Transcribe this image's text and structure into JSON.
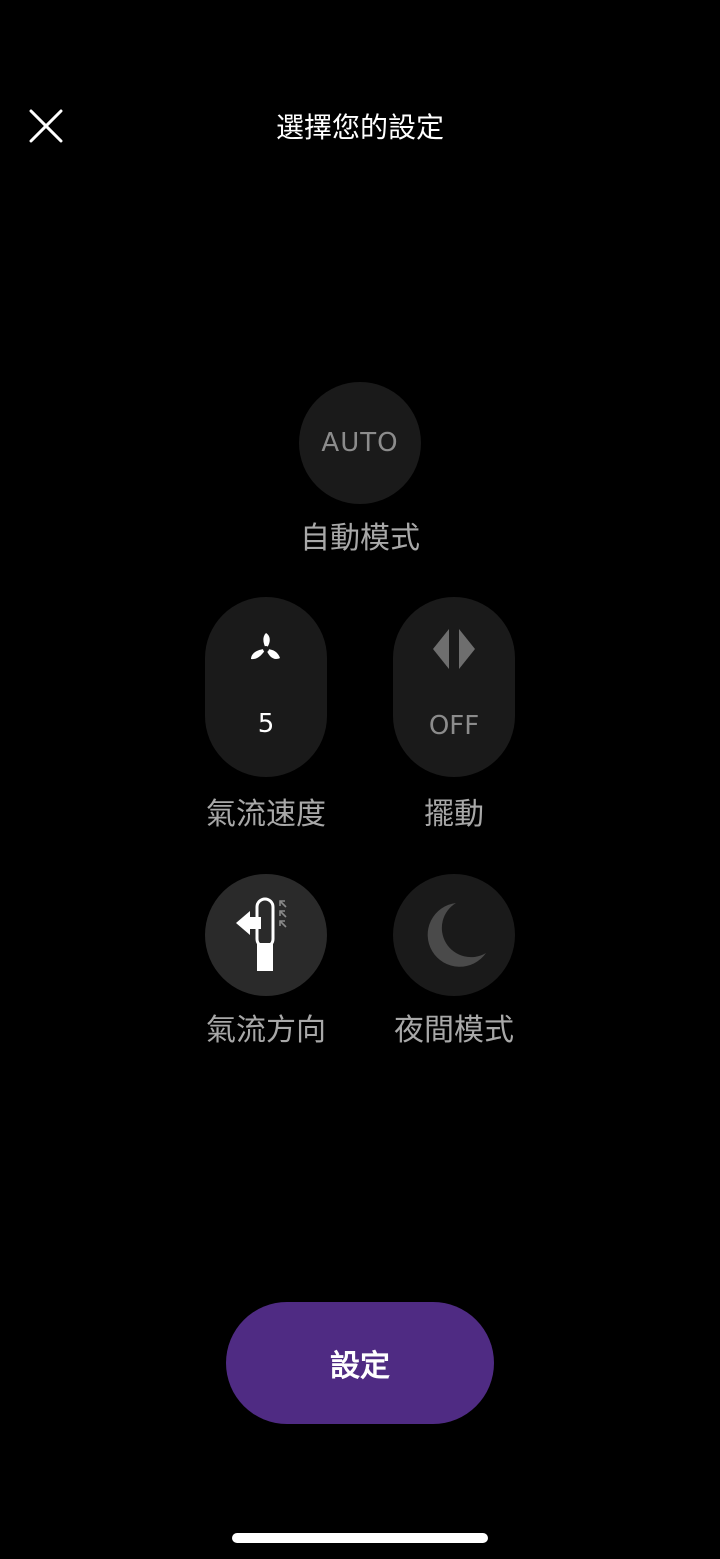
{
  "header": {
    "title": "選擇您的設定",
    "close_icon": "close-icon"
  },
  "controls": {
    "auto": {
      "value": "AUTO",
      "label": "自動模式"
    },
    "airflow_speed": {
      "icon": "fan-icon",
      "value": "5",
      "label": "氣流速度"
    },
    "oscillation": {
      "icon": "oscillation-icon",
      "value": "OFF",
      "label": "擺動"
    },
    "airflow_direction": {
      "icon": "airflow-direction-icon",
      "label": "氣流方向"
    },
    "night_mode": {
      "icon": "moon-icon",
      "label": "夜間模式"
    }
  },
  "footer": {
    "set_label": "設定"
  },
  "colors": {
    "background": "#000000",
    "control_bg": "#1a1a1a",
    "label_gray": "#a8a8a8",
    "accent_purple": "#4f2b83"
  }
}
